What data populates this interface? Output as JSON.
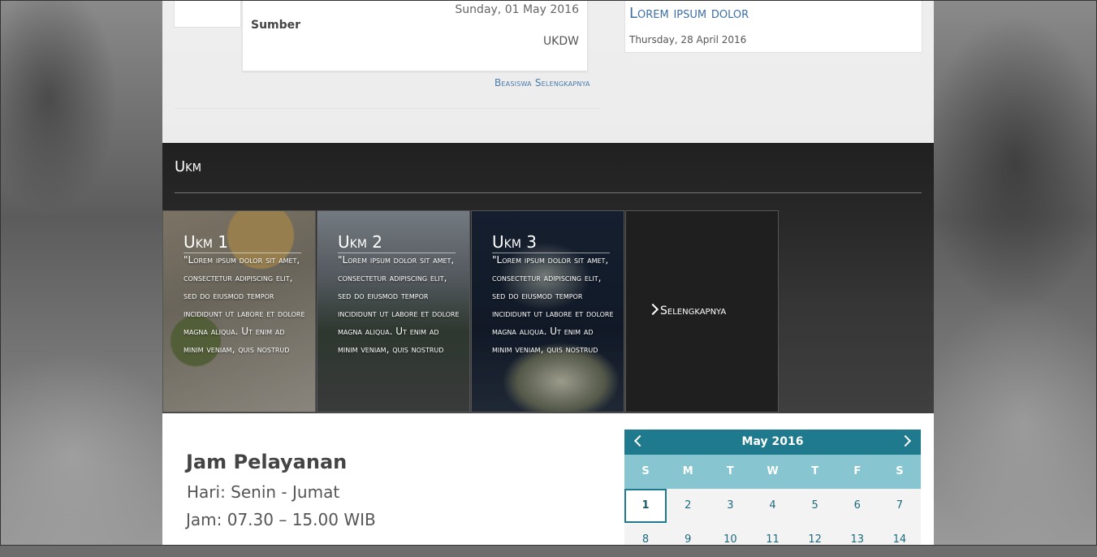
{
  "news": {
    "date": "Sunday, 01 May 2016",
    "source_label": "Sumber",
    "source": "UKDW",
    "more_link": "Beasiswa Selengkapnya"
  },
  "event": {
    "title": "Lorem ipsum dolor",
    "date": "Thursday, 28 April 2016"
  },
  "ukm": {
    "title": "Ukm",
    "tiles": [
      {
        "name": "Ukm 1",
        "desc": "\"Lorem ipsum dolor sit amet, consectetur adipiscing elit, sed do eiusmod tempor incididunt ut labore et dolore magna aliqua. Ut enim ad minim veniam, quis nostrud"
      },
      {
        "name": "Ukm 2",
        "desc": "\"Lorem ipsum dolor sit amet, consectetur adipiscing elit, sed do eiusmod tempor incididunt ut labore et dolore magna aliqua. Ut enim ad minim veniam, quis nostrud"
      },
      {
        "name": "Ukm 3",
        "desc": "\"Lorem ipsum dolor sit amet, consectetur adipiscing elit, sed do eiusmod tempor incididunt ut labore et dolore magna aliqua. Ut enim ad minim veniam, quis nostrud"
      }
    ],
    "more_label": "Selengkapnya"
  },
  "service": {
    "title": "Jam Pelayanan",
    "days": "Hari: Senin - Jumat",
    "hours": "Jam: 07.30 – 15.00 WIB"
  },
  "calendar": {
    "title": "May 2016",
    "days_of_week": [
      "S",
      "M",
      "T",
      "W",
      "T",
      "F",
      "S"
    ],
    "weeks": [
      [
        "1",
        "2",
        "3",
        "4",
        "5",
        "6",
        "7"
      ],
      [
        "8",
        "9",
        "10",
        "11",
        "12",
        "13",
        "14"
      ]
    ],
    "today": "1"
  },
  "colors": {
    "accent": "#1e7a8c",
    "accent_light": "#87c6d0",
    "link": "#3f6fa6"
  }
}
